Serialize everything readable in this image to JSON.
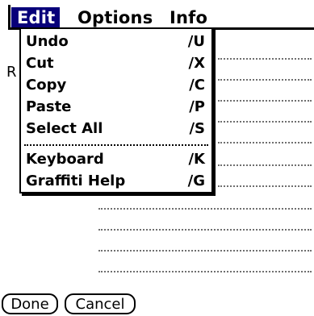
{
  "menubar": {
    "menus": [
      {
        "label": "Edit"
      },
      {
        "label": "Options"
      },
      {
        "label": "Info"
      }
    ]
  },
  "background": {
    "field_letter": "R"
  },
  "edit_menu": {
    "items": [
      {
        "label": "Undo",
        "shortcut": "∕U"
      },
      {
        "label": "Cut",
        "shortcut": "∕X"
      },
      {
        "label": "Copy",
        "shortcut": "∕C"
      },
      {
        "label": "Paste",
        "shortcut": "∕P"
      },
      {
        "label": "Select All",
        "shortcut": "∕S"
      },
      {
        "label": "Keyboard",
        "shortcut": "∕K"
      },
      {
        "label": "Graffiti Help",
        "shortcut": "∕G"
      }
    ]
  },
  "buttons": {
    "done": "Done",
    "cancel": "Cancel"
  },
  "colors": {
    "menu_highlight": "#08007a",
    "menu_text_active": "#ffffff",
    "dotline": "#6f6f6f"
  }
}
